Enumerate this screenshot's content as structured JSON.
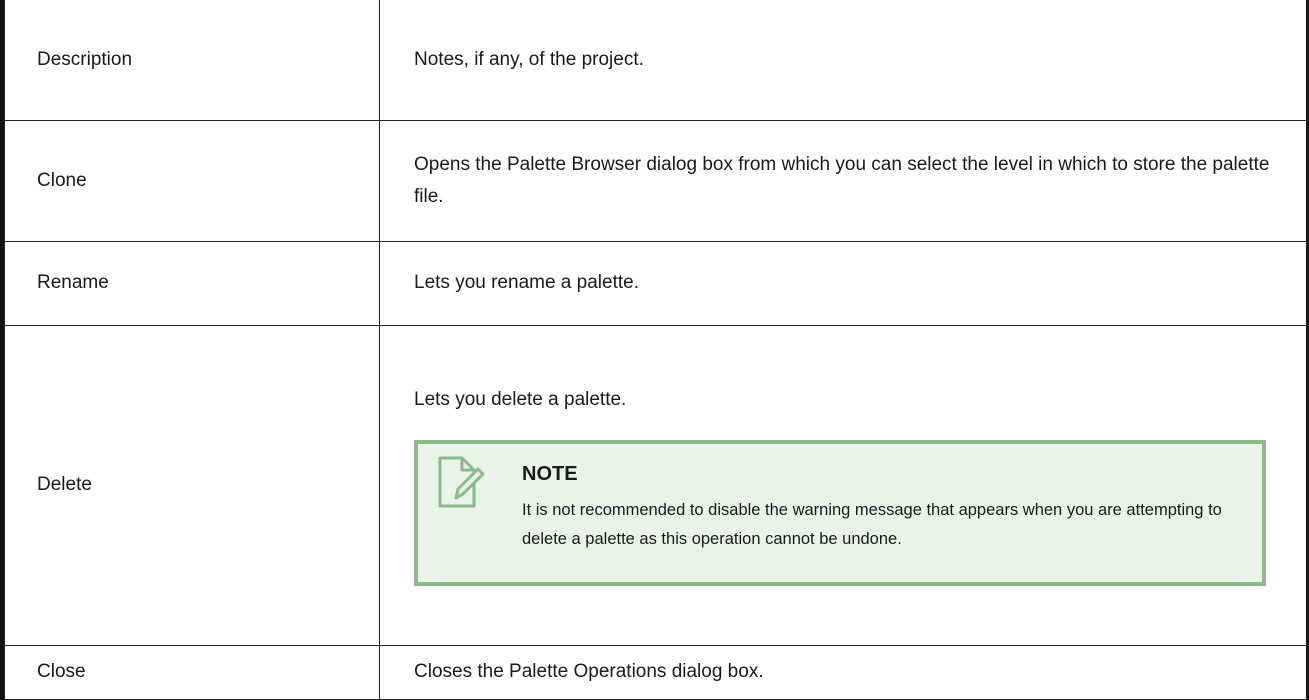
{
  "rows": [
    {
      "term": "Description",
      "description": "Notes, if any, of the project."
    },
    {
      "term": "Clone",
      "description": "Opens the Palette Browser dialog box from which you can select the level in which to store the palette file."
    },
    {
      "term": "Rename",
      "description": "Lets you rename a palette."
    },
    {
      "term": "Delete",
      "description": "Lets you delete a palette.",
      "note": {
        "title": "NOTE",
        "body": "It is not recommended to disable the warning message that appears when you are attempting to delete a palette as this operation cannot be undone.",
        "icon": "note-icon",
        "accent_color": "#8dba8d",
        "background_color": "#e8f4e8"
      }
    },
    {
      "term": "Close",
      "description": "Closes the Palette Operations dialog box."
    }
  ]
}
